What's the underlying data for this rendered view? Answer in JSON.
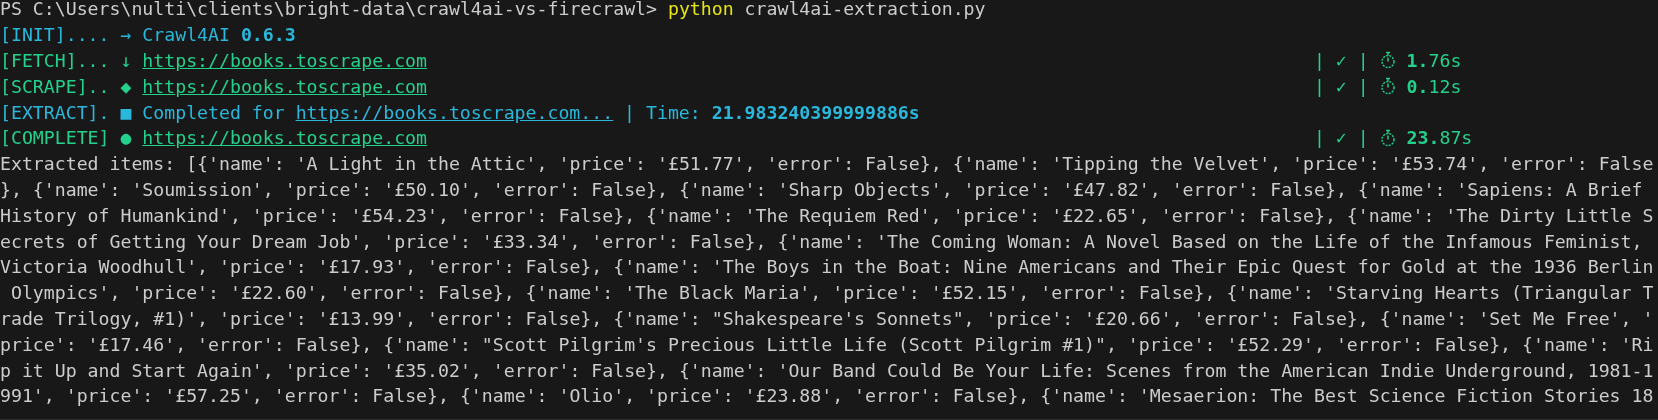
{
  "prompt": {
    "path": "PS C:\\Users\\nulti\\clients\\bright-data\\crawl4ai-vs-firecrawl>",
    "command": "python",
    "argument": "crawl4ai-extraction.py"
  },
  "log_lines": [
    {
      "tag": "[INIT]....",
      "symbol": "→",
      "color": "#29b8db",
      "segments": [
        {
          "kind": "plain",
          "text": "Crawl4AI"
        },
        {
          "kind": "bold",
          "text": "0.6.3"
        }
      ]
    },
    {
      "tag": "[FETCH]...",
      "symbol": "↓",
      "color": "#23d18b",
      "segments": [
        {
          "kind": "link",
          "text": "https://books.toscrape.com"
        }
      ],
      "status": {
        "check": "| ✓ |",
        "time": "**1.**76s"
      }
    },
    {
      "tag": "[SCRAPE]..",
      "symbol": "◆",
      "color": "#23d18b",
      "segments": [
        {
          "kind": "link",
          "text": "https://books.toscrape.com"
        }
      ],
      "status": {
        "check": "| ✓ |",
        "time": "**0.**12s"
      }
    },
    {
      "tag": "[EXTRACT].",
      "symbol": "■",
      "color": "#29b8db",
      "segments": [
        {
          "kind": "plain",
          "text": "Completed for"
        },
        {
          "kind": "link",
          "text": "https://books.toscrape.com..."
        },
        {
          "kind": "plain",
          "text": "| Time:"
        },
        {
          "kind": "bold",
          "text": "**21.**983240399999886s"
        }
      ]
    },
    {
      "tag": "[COMPLETE]",
      "symbol": "●",
      "color": "#23d18b",
      "segments": [
        {
          "kind": "link",
          "text": "https://books.toscrape.com"
        }
      ],
      "status": {
        "check": "| ✓ |",
        "time": "**23.**87s"
      }
    }
  ],
  "output_lines": [
    "Extracted items: [{'name': 'A Light in the Attic', 'price': '£51.77', 'error': False}, {'name': 'Tipping the Velvet', 'price': '£53.74', 'error': False",
    "}, {'name': 'Soumission', 'price': '£50.10', 'error': False}, {'name': 'Sharp Objects', 'price': '£47.82', 'error': False}, {'name': 'Sapiens: A Brief",
    "History of Humankind', 'price': '£54.23', 'error': False}, {'name': 'The Requiem Red', 'price': '£22.65', 'error': False}, {'name': 'The Dirty Little S",
    "ecrets of Getting Your Dream Job', 'price': '£33.34', 'error': False}, {'name': 'The Coming Woman: A Novel Based on the Life of the Infamous Feminist,",
    "Victoria Woodhull', 'price': '£17.93', 'error': False}, {'name': 'The Boys in the Boat: Nine Americans and Their Epic Quest for Gold at the 1936 Berlin",
    " Olympics', 'price': '£22.60', 'error': False}, {'name': 'The Black Maria', 'price': '£52.15', 'error': False}, {'name': 'Starving Hearts (Triangular T",
    "rade Trilogy, #1)', 'price': '£13.99', 'error': False}, {'name': \"Shakespeare's Sonnets\", 'price': '£20.66', 'error': False}, {'name': 'Set Me Free', '",
    "price': '£17.46', 'error': False}, {'name': \"Scott Pilgrim's Precious Little Life (Scott Pilgrim #1)\", 'price': '£52.29', 'error': False}, {'name': 'Ri",
    "p it Up and Start Again', 'price': '£35.02', 'error': False}, {'name': 'Our Band Could Be Your Life: Scenes from the American Indie Underground, 1981-1",
    "991', 'price': '£57.25', 'error': False}, {'name': 'Olio', 'price': '£23.88', 'error': False}, {'name': 'Mesaerion: The Best Science Fiction Stories 18"
  ]
}
